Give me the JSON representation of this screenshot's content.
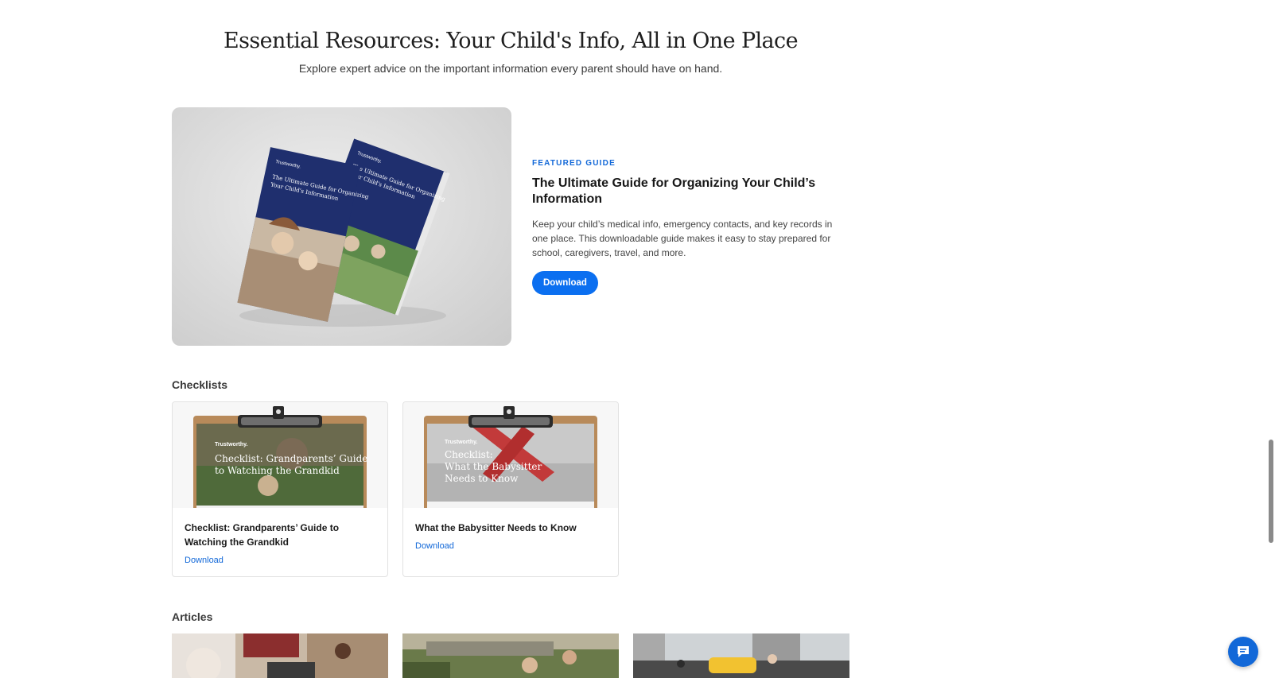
{
  "hero": {
    "title": "Essential Resources: Your Child's Info, All in One Place",
    "subtitle": "Explore expert advice on the important information every parent should have on hand."
  },
  "featured": {
    "eyebrow": "FEATURED GUIDE",
    "title": "The Ultimate Guide for Organizing Your Child’s Information",
    "description": "Keep your child’s medical info, emergency contacts, and key records in one place. This downloadable guide makes it easy to stay prepared for school, caregivers, travel, and more.",
    "button_label": "Download",
    "book": {
      "brand": "Trustworthy.",
      "cover_title_line1": "The Ultimate Guide for Organizing",
      "cover_title_line2": "Your Child's Information"
    }
  },
  "checklists": {
    "heading": "Checklists",
    "items": [
      {
        "title": "Checklist: Grandparents’ Guide to Watching the Grandkid",
        "link_label": "Download",
        "thumb_brand": "Trustworthy.",
        "thumb_line1": "Checklist: Grandparents’ Guide",
        "thumb_line2": "to Watching the Grandkid"
      },
      {
        "title": "What the Babysitter Needs to Know",
        "link_label": "Download",
        "thumb_brand": "Trustworthy.",
        "thumb_line1": "Checklist:",
        "thumb_line2": "What the Babysitter",
        "thumb_line3": "Needs to Know"
      }
    ]
  },
  "articles": {
    "heading": "Articles"
  },
  "colors": {
    "accent": "#1268d8",
    "button": "#0b6ff0",
    "book_cover": "#1f2f6e",
    "clipboard": "#b88a5a"
  },
  "icons": {
    "chat": "chat-bubble-icon"
  }
}
